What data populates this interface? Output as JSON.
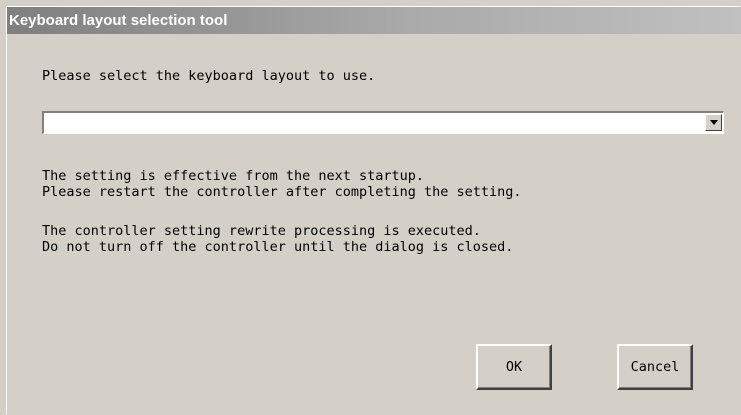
{
  "window": {
    "title": "Keyboard layout selection tool"
  },
  "prompt": "Please select the keyboard layout to use.",
  "layout_select": {
    "selected_value": ""
  },
  "notes": {
    "line1": "The setting is effective from the next startup.",
    "line2": "Please restart the controller after completing the setting.",
    "line3": "The controller setting rewrite processing is executed.",
    "line4": "Do not turn off the controller until the dialog is closed."
  },
  "buttons": {
    "ok_label": "OK",
    "cancel_label": "Cancel"
  },
  "icons": {
    "dropdown": "chevron-down-icon"
  },
  "colors": {
    "dialog_bg": "#d4d0c8",
    "titlebar_start": "#7f7f7f",
    "titlebar_end": "#c0c0c0"
  }
}
